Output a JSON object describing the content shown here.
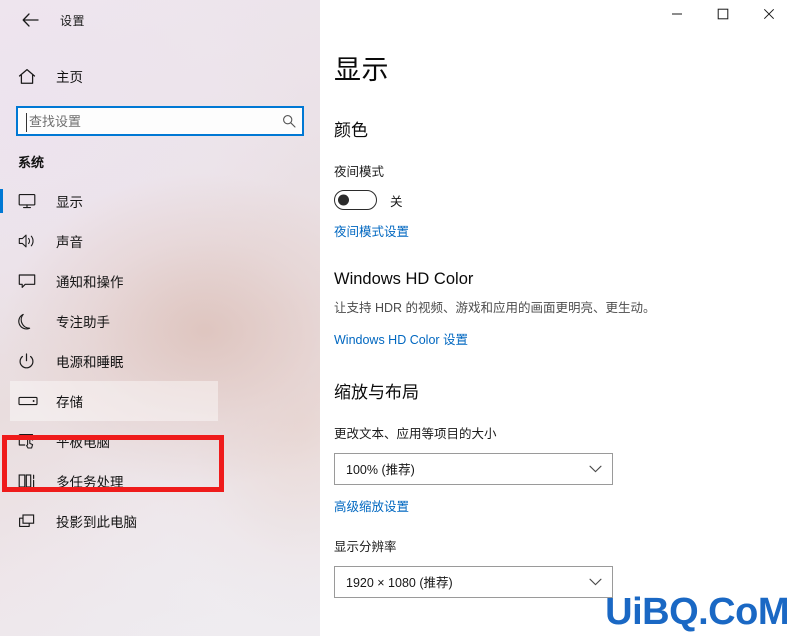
{
  "window": {
    "title": "设置",
    "back_icon": "back-arrow-icon",
    "controls": {
      "minimize": "minimize-icon",
      "maximize": "maximize-icon",
      "close": "close-icon"
    }
  },
  "sidebar": {
    "home": {
      "label": "主页",
      "icon": "home-icon"
    },
    "search": {
      "placeholder": "查找设置",
      "value": "",
      "icon": "search-icon"
    },
    "group_title": "系统",
    "items": [
      {
        "label": "显示",
        "icon": "monitor-icon",
        "selected": true,
        "highlighted": false
      },
      {
        "label": "声音",
        "icon": "speaker-icon",
        "selected": false,
        "highlighted": false
      },
      {
        "label": "通知和操作",
        "icon": "notification-icon",
        "selected": false,
        "highlighted": false
      },
      {
        "label": "专注助手",
        "icon": "moon-icon",
        "selected": false,
        "highlighted": false
      },
      {
        "label": "电源和睡眠",
        "icon": "power-icon",
        "selected": false,
        "highlighted": false
      },
      {
        "label": "存储",
        "icon": "storage-icon",
        "selected": false,
        "highlighted": true
      },
      {
        "label": "平板电脑",
        "icon": "tablet-icon",
        "selected": false,
        "highlighted": false
      },
      {
        "label": "多任务处理",
        "icon": "multitask-icon",
        "selected": false,
        "highlighted": false
      },
      {
        "label": "投影到此电脑",
        "icon": "project-icon",
        "selected": false,
        "highlighted": false
      }
    ]
  },
  "annotation": {
    "type": "red-rectangle",
    "color": "#ef1b1b",
    "targets": "存储"
  },
  "main": {
    "page_title": "显示",
    "sections": [
      {
        "heading": "颜色",
        "field_label": "夜间模式",
        "toggle_state": "关",
        "toggle_on": false,
        "link": "夜间模式设置"
      },
      {
        "heading": "Windows HD Color",
        "body": "让支持 HDR 的视频、游戏和应用的画面更明亮、更生动。",
        "link": "Windows HD Color 设置"
      },
      {
        "heading": "缩放与布局",
        "field_label": "更改文本、应用等项目的大小",
        "combo_value": "100% (推荐)",
        "link": "高级缩放设置"
      },
      {
        "field_label": "显示分辨率",
        "combo_value": "1920 × 1080 (推荐)"
      }
    ]
  },
  "watermark": {
    "text": "UiBQ.CoM",
    "color": "#1a68c4"
  },
  "theme": {
    "accent": "#0078d4",
    "link": "#0067c0",
    "annotation_red": "#ef1b1b",
    "sidebar_bg": "#eee7ee",
    "main_bg": "#ffffff"
  }
}
